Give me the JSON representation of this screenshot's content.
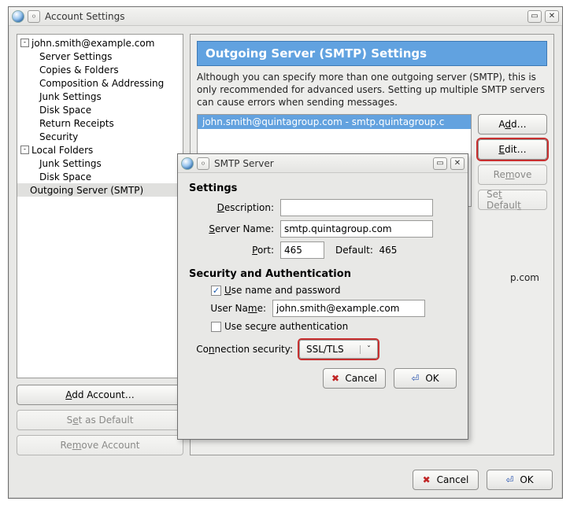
{
  "main_window": {
    "title": "Account Settings",
    "tree": {
      "account1": "john.smith@example.com",
      "a1_items": [
        "Server Settings",
        "Copies & Folders",
        "Composition & Addressing",
        "Junk Settings",
        "Disk Space",
        "Return Receipts",
        "Security"
      ],
      "account2": "Local Folders",
      "a2_items": [
        "Junk Settings",
        "Disk Space"
      ],
      "smtp_root": "Outgoing Server (SMTP)"
    },
    "sidebar_buttons": {
      "add_account": "Add Account…",
      "set_default": "Set as Default",
      "remove_account": "Remove Account"
    },
    "content": {
      "header": "Outgoing Server (SMTP) Settings",
      "desc": "Although you can specify more than one outgoing server (SMTP), this is only recommended for advanced users. Setting up multiple SMTP servers can cause errors when sending messages.",
      "list_item": "john.smith@quintagroup.com - smtp.quintagroup.c",
      "buttons": {
        "add": "Add…",
        "edit": "Edit…",
        "remove": "Remove",
        "set_default": "Set Default"
      },
      "detail_suffix": "p.com"
    },
    "bottom": {
      "cancel": "Cancel",
      "ok": "OK"
    }
  },
  "smtp_dialog": {
    "title": "SMTP Server",
    "settings_heading": "Settings",
    "desc_label": "Description:",
    "desc_value": "",
    "server_label": "Server Name:",
    "server_value": "smtp.quintagroup.com",
    "port_label": "Port:",
    "port_value": "465",
    "default_label": "Default:",
    "default_value": "465",
    "sec_heading": "Security and Authentication",
    "use_namepass": "Use name and password",
    "use_namepass_checked": true,
    "username_label": "User Name:",
    "username_value": "john.smith@example.com",
    "secure_auth": "Use secure authentication",
    "secure_auth_checked": false,
    "conn_sec_label": "Connection security:",
    "conn_sec_value": "SSL/TLS",
    "cancel": "Cancel",
    "ok": "OK"
  }
}
